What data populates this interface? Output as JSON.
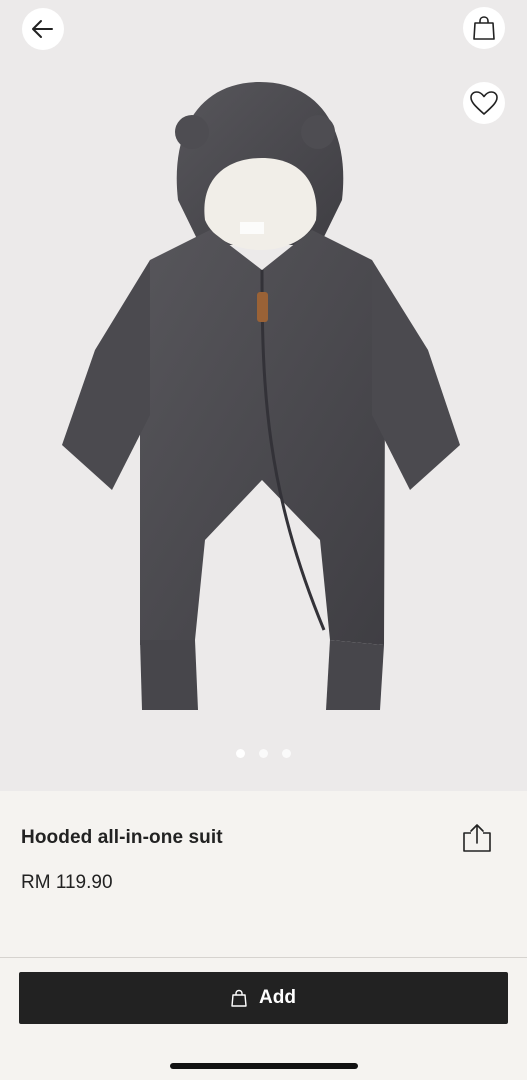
{
  "header": {
    "back_icon": "arrow-left-icon",
    "bag_icon": "shopping-bag-icon",
    "favorite_icon": "heart-icon"
  },
  "gallery": {
    "image_subject": "product-photo",
    "total_images": 3,
    "active_index": 0
  },
  "product": {
    "title": "Hooded all-in-one suit",
    "price": "RM 119.90",
    "share_icon": "share-icon"
  },
  "cta": {
    "label": "Add",
    "icon": "shopping-bag-icon"
  },
  "colors": {
    "cta_background": "#222222",
    "page_background": "#f5f3f0",
    "hero_background": "#eceaea",
    "garment": "#4a494d"
  }
}
